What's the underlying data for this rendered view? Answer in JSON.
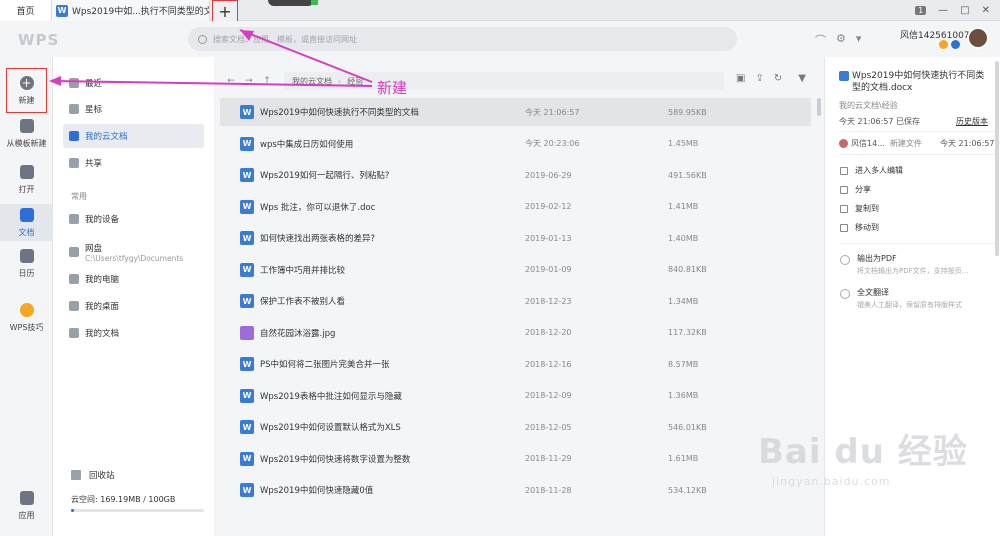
{
  "tabs": {
    "home": "首页",
    "doc": "Wps2019中如...执行不同类型的文档",
    "doc_badge": "W",
    "new_tab": "+"
  },
  "window": {
    "notif": "1"
  },
  "header": {
    "logo": "WPS",
    "search_placeholder": "搜索文档、应用、模板，或直接访问网址",
    "user_name": "风信1425610076"
  },
  "leftnav": {
    "new": "新建",
    "template_new": "从模板新建",
    "open": "打开",
    "docs": "文档",
    "calendar": "日历",
    "tips": "WPS技巧",
    "apps": "应用"
  },
  "sidebar": {
    "recent": "最近",
    "starred": "星标",
    "cloud": "我的云文档",
    "shared": "共享",
    "section": "常用",
    "devices": "我的设备",
    "netdisk": "网盘",
    "netdisk_path": "C:\\Users\\tfygy\\Documents",
    "computer": "我的电脑",
    "desktop": "我的桌面",
    "mydocs": "我的文档",
    "recycle": "回收站",
    "quota": "云空间: 169.19MB / 100GB",
    "quota_fraction": 0.0017,
    "expand": "扩容"
  },
  "path": {
    "root": "我的云文档",
    "current": "经验"
  },
  "files": [
    {
      "name": "Wps2019中如何快速执行不同类型的文档",
      "date": "今天 21:06:57",
      "size": "589.95KB",
      "type": "W"
    },
    {
      "name": "wps中集成日历如何使用",
      "date": "今天 20:23:06",
      "size": "1.45MB",
      "type": "W"
    },
    {
      "name": "Wps2019如何一起隔行、列粘贴?",
      "date": "2019-06-29",
      "size": "491.56KB",
      "type": "W"
    },
    {
      "name": "Wps 批注，你可以退休了.doc",
      "date": "2019-02-12",
      "size": "1.41MB",
      "type": "W"
    },
    {
      "name": "如何快速找出两张表格的差异?",
      "date": "2019-01-13",
      "size": "1.40MB",
      "type": "W"
    },
    {
      "name": "工作簿中巧用并排比较",
      "date": "2019-01-09",
      "size": "840.81KB",
      "type": "W"
    },
    {
      "name": "保护工作表不被别人看",
      "date": "2018-12-23",
      "size": "1.34MB",
      "type": "W"
    },
    {
      "name": "自然花园沐浴露.jpg",
      "date": "2018-12-20",
      "size": "117.32KB",
      "type": "IMG"
    },
    {
      "name": "PS中如何将二张图片完美合并一张",
      "date": "2018-12-16",
      "size": "8.57MB",
      "type": "W"
    },
    {
      "name": "Wps2019表格中批注如何显示与隐藏",
      "date": "2018-12-09",
      "size": "1.36MB",
      "type": "W"
    },
    {
      "name": "Wps2019中如何设置默认格式为XLS",
      "date": "2018-12-05",
      "size": "546.01KB",
      "type": "W"
    },
    {
      "name": "Wps2019中如何快速将数字设置为整数",
      "date": "2018-11-29",
      "size": "1.61MB",
      "type": "W"
    },
    {
      "name": "Wps2019中如何快速隐藏0值",
      "date": "2018-11-28",
      "size": "534.12KB",
      "type": "W"
    }
  ],
  "details": {
    "title": "Wps2019中如何快速执行不同类型的文档.docx",
    "path": "我的云文档\\经验",
    "time": "今天 21:06:57",
    "time_label": "已保存",
    "version": "历史版本",
    "user": "风信14...",
    "user_action": "新建文件",
    "user_time": "今天 21:06:57",
    "actions": [
      "进入多人编辑",
      "分享",
      "复制到",
      "移动到"
    ],
    "services": [
      {
        "title": "输出为PDF",
        "desc": "将文档输出为PDF文件，支持按页..."
      },
      {
        "title": "全文翻译",
        "desc": "媲美人工翻译，保留原有排版样式"
      }
    ]
  },
  "annotation": "新建",
  "watermark": {
    "main": "Bai du 经验",
    "sub": "jingyan.baidu.com"
  },
  "colors": {
    "accent": "#2d6fd6",
    "annotation": "#d63ec0",
    "highlight_box": "#e53935",
    "word_icon": "#3a7bd5",
    "image_icon": "#9c6dd8"
  }
}
